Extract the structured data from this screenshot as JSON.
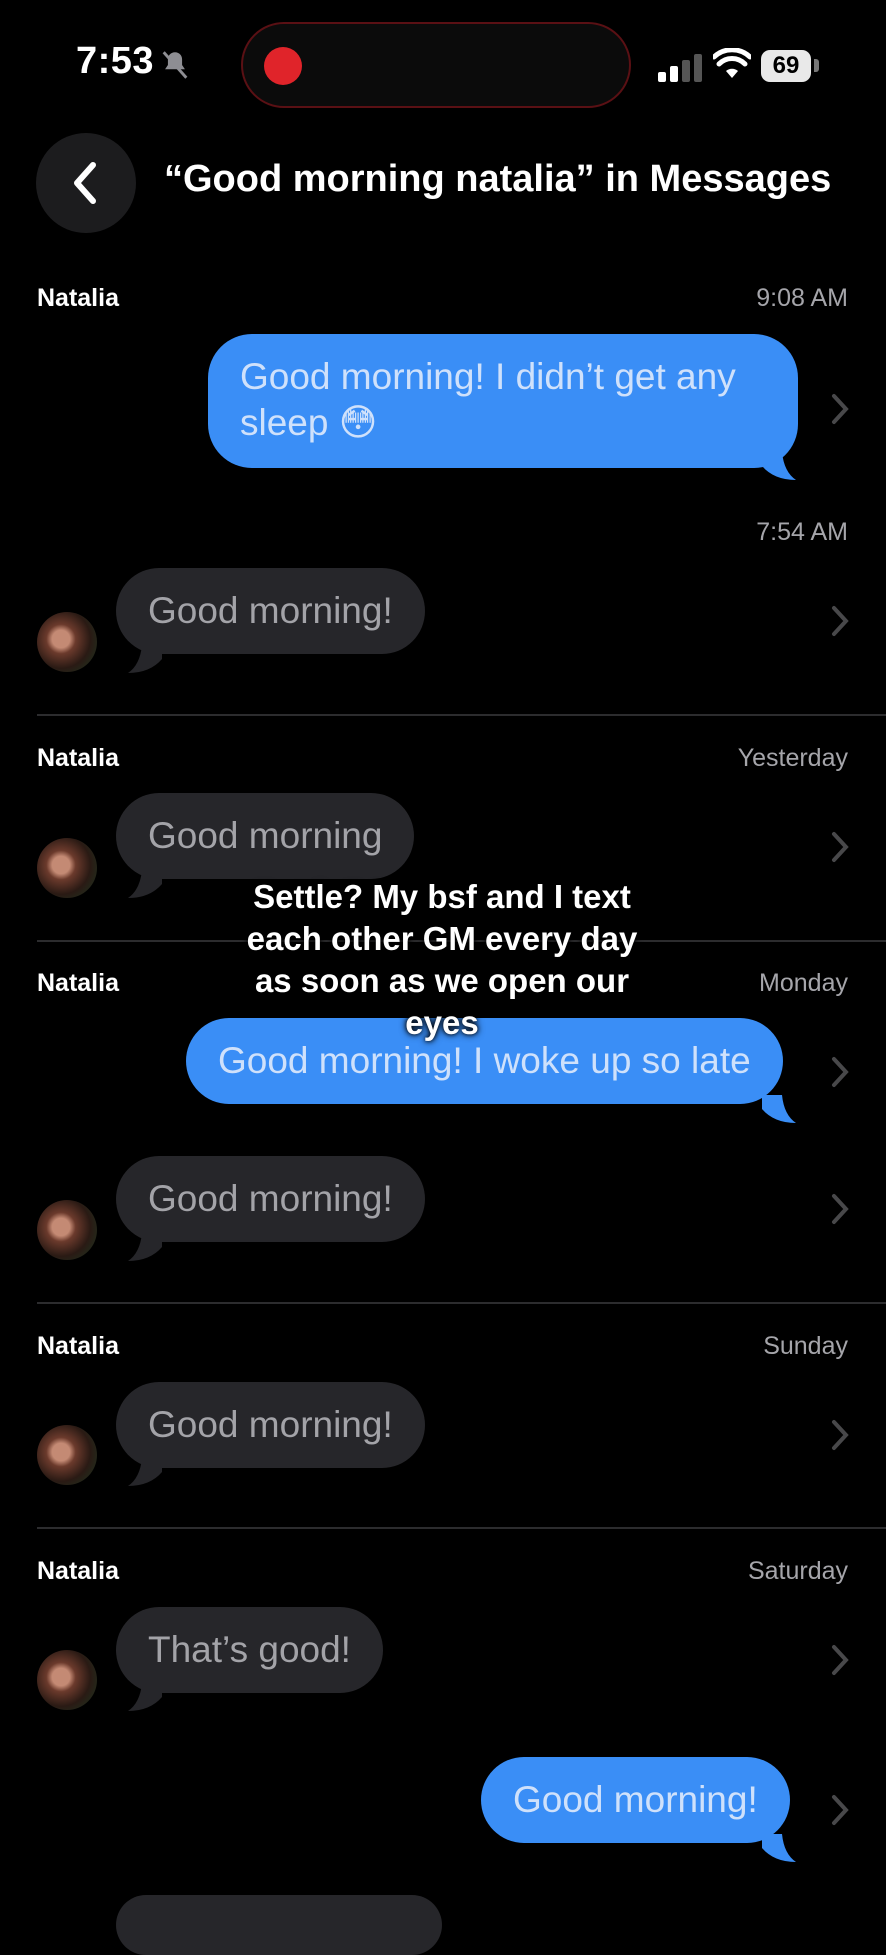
{
  "status_bar": {
    "time": "7:53",
    "battery": "69"
  },
  "header": {
    "title": "“Good morning natalia” in Messages"
  },
  "results": [
    {
      "name": "Natalia",
      "timestamp": "9:08 AM",
      "outgoing": "Good morning! I didn’t get any sleep 😳",
      "sub_timestamp": "7:54 AM",
      "incoming": "Good morning!"
    },
    {
      "name": "Natalia",
      "timestamp": "Yesterday",
      "incoming": "Good morning"
    },
    {
      "name": "Natalia",
      "timestamp": "Monday",
      "outgoing": "Good morning! I woke up so late",
      "incoming": "Good morning!"
    },
    {
      "name": "Natalia",
      "timestamp": "Sunday",
      "incoming": "Good morning!"
    },
    {
      "name": "Natalia",
      "timestamp": "Saturday",
      "incoming": "That’s good!",
      "outgoing": "Good morning!"
    }
  ],
  "overlay_caption": "Settle? My bsf and I text each other GM every day as soon as we open our eyes",
  "colors": {
    "outgoing_bubble": "#3a8ef6",
    "incoming_bubble": "#26262a",
    "background": "#000000"
  },
  "icons": [
    "mute-bell-icon",
    "record-dot-icon",
    "signal-icon",
    "wifi-icon",
    "battery-icon",
    "back-chevron-icon",
    "chevron-right-icon"
  ]
}
